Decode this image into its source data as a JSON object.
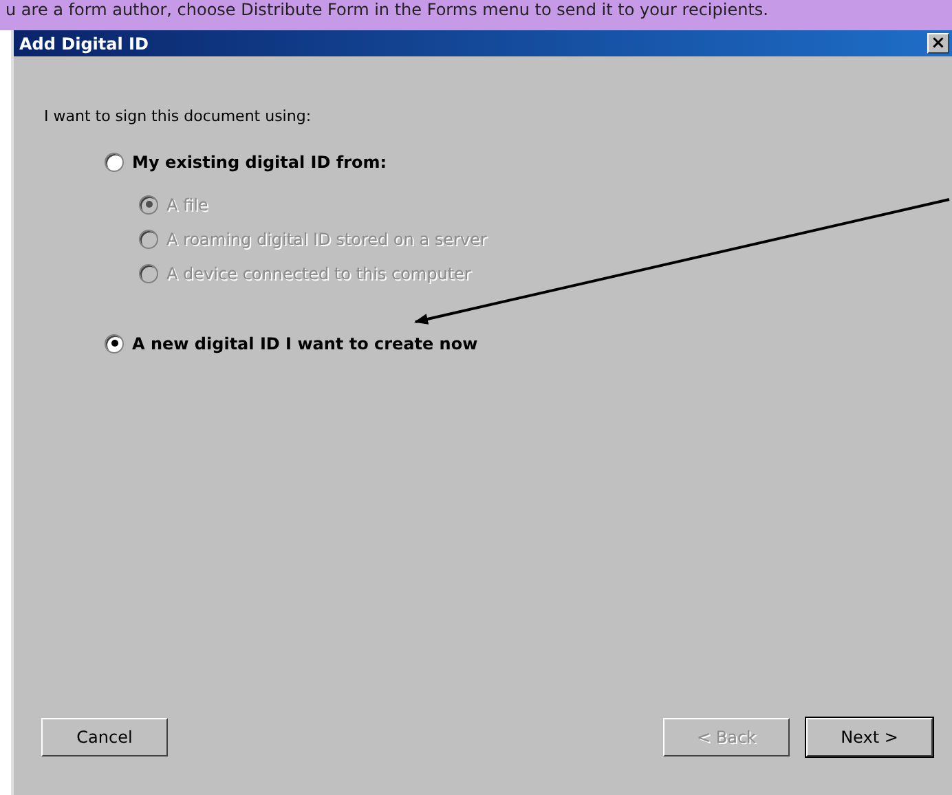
{
  "background_page": {
    "text": "u are a form author, choose Distribute Form in the Forms menu to send it to your recipients."
  },
  "window": {
    "title": "Add Digital ID",
    "close": "×"
  },
  "prompt": "I want to sign this document using:",
  "options": [
    {
      "label": "My existing digital ID from:",
      "selected": false,
      "disabled": false,
      "children": [
        {
          "label": "A file",
          "selected": true,
          "disabled": true
        },
        {
          "label": "A roaming digital ID stored on a server",
          "selected": false,
          "disabled": true
        },
        {
          "label": "A device connected to this computer",
          "selected": false,
          "disabled": true
        }
      ]
    },
    {
      "label": "A new digital ID I want to create now",
      "selected": true,
      "disabled": false
    }
  ],
  "buttons": [
    {
      "label": "Cancel",
      "kind": "left",
      "disabled": false,
      "default": false
    },
    {
      "label": "< Back",
      "kind": "right",
      "disabled": true,
      "default": false
    },
    {
      "label": "Next >",
      "kind": "right",
      "disabled": false,
      "default": true
    }
  ]
}
